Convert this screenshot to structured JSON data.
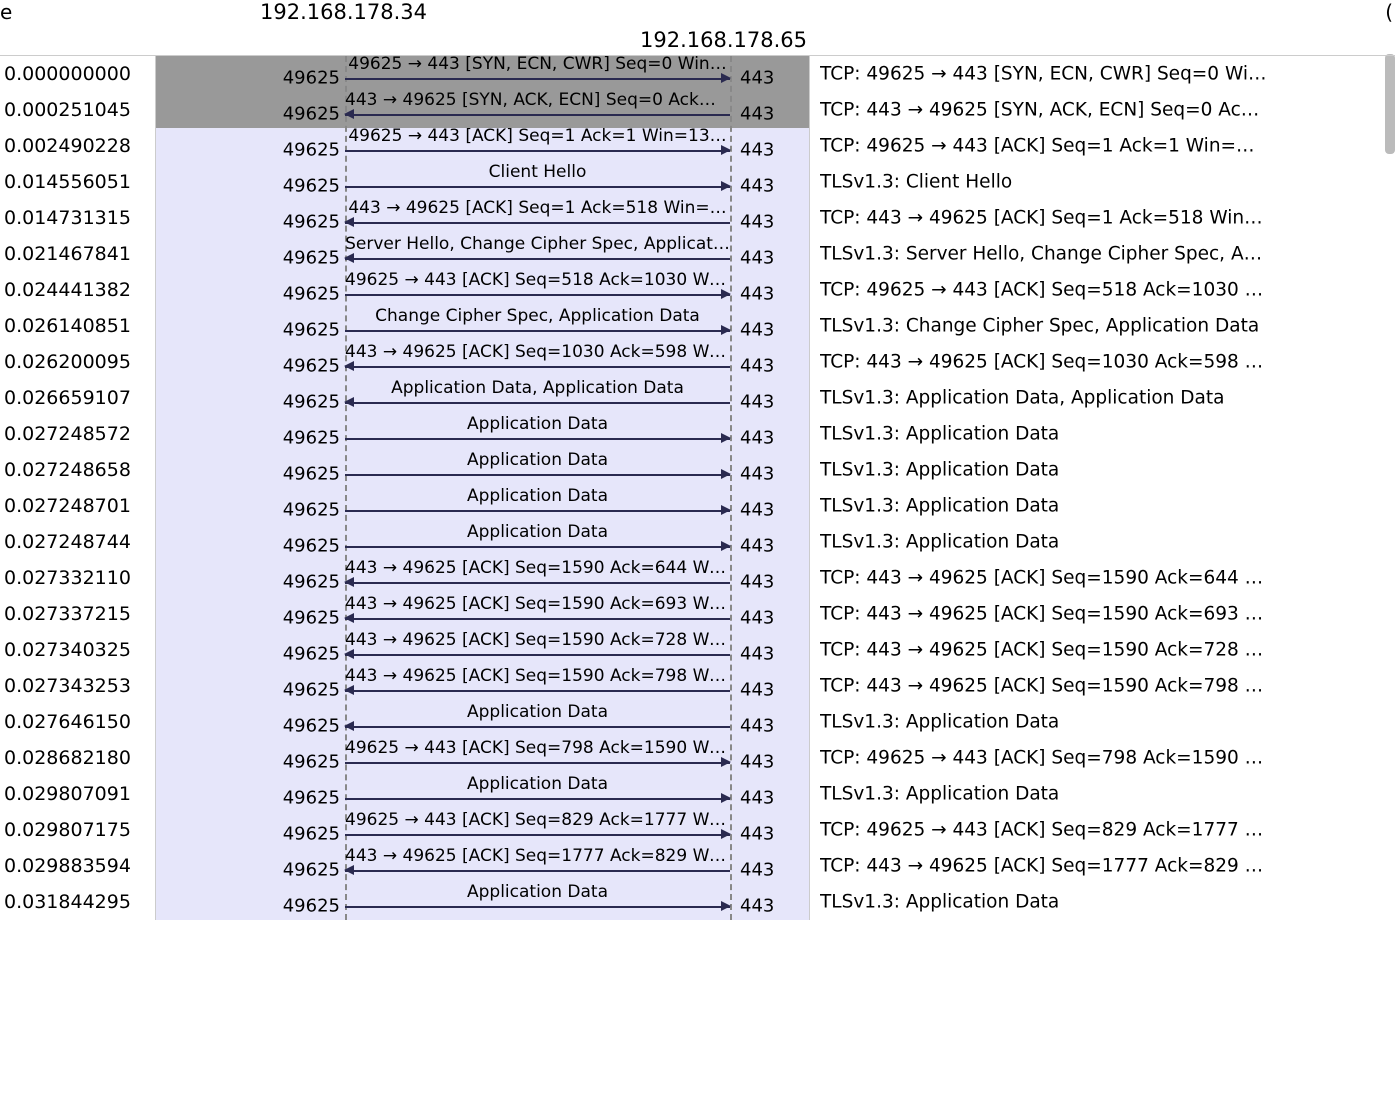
{
  "hosts": {
    "a": "192.168.178.34",
    "b": "192.168.178.65"
  },
  "corner_left": "e",
  "corner_right": "(",
  "rows": [
    {
      "time": "0.000000000",
      "pl": "49625",
      "pr": "443",
      "dir": "r",
      "sel": true,
      "label": "49625 → 443 [SYN, ECN, CWR] Seq=0 Win…",
      "comment": "TCP: 49625 → 443 [SYN, ECN, CWR] Seq=0 Wi…"
    },
    {
      "time": "0.000251045",
      "pl": "49625",
      "pr": "443",
      "dir": "l",
      "sel": true,
      "label": "443 → 49625 [SYN, ACK, ECN] Seq=0 Ack=…",
      "comment": "TCP: 443 → 49625 [SYN, ACK, ECN] Seq=0 Ac…"
    },
    {
      "time": "0.002490228",
      "pl": "49625",
      "pr": "443",
      "dir": "r",
      "sel": false,
      "label": "49625 → 443 [ACK] Seq=1 Ack=1 Win=13…",
      "comment": "TCP: 49625 → 443 [ACK] Seq=1 Ack=1 Win=…"
    },
    {
      "time": "0.014556051",
      "pl": "49625",
      "pr": "443",
      "dir": "r",
      "sel": false,
      "label": "Client Hello",
      "comment": "TLSv1.3: Client Hello"
    },
    {
      "time": "0.014731315",
      "pl": "49625",
      "pr": "443",
      "dir": "l",
      "sel": false,
      "label": "443 → 49625 [ACK] Seq=1 Ack=518 Win=…",
      "comment": "TCP: 443 → 49625 [ACK] Seq=1 Ack=518 Win…"
    },
    {
      "time": "0.021467841",
      "pl": "49625",
      "pr": "443",
      "dir": "l",
      "sel": false,
      "label": "Server Hello, Change Cipher Spec, Applicat…",
      "comment": "TLSv1.3: Server Hello, Change Cipher Spec, A…"
    },
    {
      "time": "0.024441382",
      "pl": "49625",
      "pr": "443",
      "dir": "r",
      "sel": false,
      "label": "49625 → 443 [ACK] Seq=518 Ack=1030 Wi…",
      "comment": "TCP: 49625 → 443 [ACK] Seq=518 Ack=1030 …"
    },
    {
      "time": "0.026140851",
      "pl": "49625",
      "pr": "443",
      "dir": "r",
      "sel": false,
      "label": "Change Cipher Spec, Application Data",
      "comment": "TLSv1.3: Change Cipher Spec, Application Data"
    },
    {
      "time": "0.026200095",
      "pl": "49625",
      "pr": "443",
      "dir": "l",
      "sel": false,
      "label": "443 → 49625 [ACK] Seq=1030 Ack=598 Wi…",
      "comment": "TCP: 443 → 49625 [ACK] Seq=1030 Ack=598 …"
    },
    {
      "time": "0.026659107",
      "pl": "49625",
      "pr": "443",
      "dir": "l",
      "sel": false,
      "label": "Application Data, Application Data",
      "comment": "TLSv1.3: Application Data, Application Data"
    },
    {
      "time": "0.027248572",
      "pl": "49625",
      "pr": "443",
      "dir": "r",
      "sel": false,
      "label": "Application Data",
      "comment": "TLSv1.3: Application Data"
    },
    {
      "time": "0.027248658",
      "pl": "49625",
      "pr": "443",
      "dir": "r",
      "sel": false,
      "label": "Application Data",
      "comment": "TLSv1.3: Application Data"
    },
    {
      "time": "0.027248701",
      "pl": "49625",
      "pr": "443",
      "dir": "r",
      "sel": false,
      "label": "Application Data",
      "comment": "TLSv1.3: Application Data"
    },
    {
      "time": "0.027248744",
      "pl": "49625",
      "pr": "443",
      "dir": "r",
      "sel": false,
      "label": "Application Data",
      "comment": "TLSv1.3: Application Data"
    },
    {
      "time": "0.027332110",
      "pl": "49625",
      "pr": "443",
      "dir": "l",
      "sel": false,
      "label": "443 → 49625 [ACK] Seq=1590 Ack=644 Wi…",
      "comment": "TCP: 443 → 49625 [ACK] Seq=1590 Ack=644 …"
    },
    {
      "time": "0.027337215",
      "pl": "49625",
      "pr": "443",
      "dir": "l",
      "sel": false,
      "label": "443 → 49625 [ACK] Seq=1590 Ack=693 Wi…",
      "comment": "TCP: 443 → 49625 [ACK] Seq=1590 Ack=693 …"
    },
    {
      "time": "0.027340325",
      "pl": "49625",
      "pr": "443",
      "dir": "l",
      "sel": false,
      "label": "443 → 49625 [ACK] Seq=1590 Ack=728 Wi…",
      "comment": "TCP: 443 → 49625 [ACK] Seq=1590 Ack=728 …"
    },
    {
      "time": "0.027343253",
      "pl": "49625",
      "pr": "443",
      "dir": "l",
      "sel": false,
      "label": "443 → 49625 [ACK] Seq=1590 Ack=798 Wi…",
      "comment": "TCP: 443 → 49625 [ACK] Seq=1590 Ack=798 …"
    },
    {
      "time": "0.027646150",
      "pl": "49625",
      "pr": "443",
      "dir": "l",
      "sel": false,
      "label": "Application Data",
      "comment": "TLSv1.3: Application Data"
    },
    {
      "time": "0.028682180",
      "pl": "49625",
      "pr": "443",
      "dir": "r",
      "sel": false,
      "label": "49625 → 443 [ACK] Seq=798 Ack=1590 Wi…",
      "comment": "TCP: 49625 → 443 [ACK] Seq=798 Ack=1590 …"
    },
    {
      "time": "0.029807091",
      "pl": "49625",
      "pr": "443",
      "dir": "r",
      "sel": false,
      "label": "Application Data",
      "comment": "TLSv1.3: Application Data"
    },
    {
      "time": "0.029807175",
      "pl": "49625",
      "pr": "443",
      "dir": "r",
      "sel": false,
      "label": "49625 → 443 [ACK] Seq=829 Ack=1777 Wi…",
      "comment": "TCP: 49625 → 443 [ACK] Seq=829 Ack=1777 …"
    },
    {
      "time": "0.029883594",
      "pl": "49625",
      "pr": "443",
      "dir": "l",
      "sel": false,
      "label": "443 → 49625 [ACK] Seq=1777 Ack=829 Wi…",
      "comment": "TCP: 443 → 49625 [ACK] Seq=1777 Ack=829 …"
    },
    {
      "time": "0.031844295",
      "pl": "49625",
      "pr": "443",
      "dir": "r",
      "sel": false,
      "label": "Application Data",
      "comment": "TLSv1.3: Application Data"
    }
  ]
}
